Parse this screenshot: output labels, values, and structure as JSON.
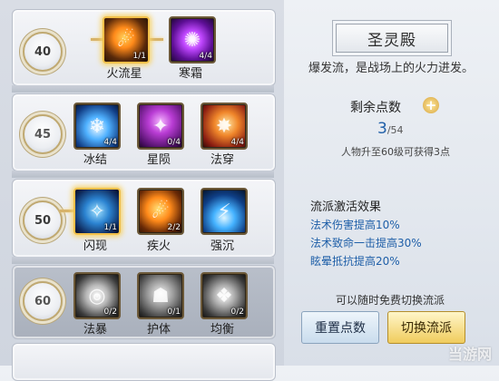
{
  "talent_tree": {
    "rows": [
      {
        "level": "40",
        "skills": [
          {
            "name": "火流星",
            "count": "1/1",
            "icon": "meteor-icon",
            "selected": true
          },
          {
            "name": "寒霜",
            "count": "4/4",
            "icon": "frost-icon"
          }
        ]
      },
      {
        "level": "45",
        "skills": [
          {
            "name": "冰结",
            "count": "4/4",
            "icon": "freeze-icon"
          },
          {
            "name": "星陨",
            "count": "0/4",
            "icon": "star-fall-icon"
          },
          {
            "name": "法穿",
            "count": "4/4",
            "icon": "spell-pierce-icon"
          }
        ]
      },
      {
        "level": "50",
        "skills": [
          {
            "name": "闪现",
            "count": "1/1",
            "icon": "flash-icon",
            "selected": true
          },
          {
            "name": "疾火",
            "count": "2/2",
            "icon": "swift-fire-icon"
          },
          {
            "name": "强沉",
            "count": "",
            "icon": "sink-icon"
          }
        ]
      },
      {
        "level": "60",
        "locked": true,
        "skills": [
          {
            "name": "法暴",
            "count": "0/2",
            "icon": "spell-crit-icon"
          },
          {
            "name": "护体",
            "count": "0/1",
            "icon": "guard-icon"
          },
          {
            "name": "均衡",
            "count": "0/2",
            "icon": "balance-icon"
          }
        ]
      }
    ]
  },
  "info": {
    "title": "圣灵殿",
    "description": "爆发流，是战场上的火力进发。",
    "remaining_label": "剩余点数",
    "points_current": "3",
    "points_max": "/54",
    "hint": "人物升至60级可获得3点",
    "effects_title": "流派激活效果",
    "effects": [
      "法术伤害提高10%",
      "法术致命一击提高30%",
      "眩晕抵抗提高20%"
    ],
    "switch_hint": "可以随时免费切换流派",
    "reset_button": "重置点数",
    "switch_button": "切换流派"
  },
  "watermark": "当游网",
  "colors": {
    "accent_blue": "#1f5fa8",
    "gold": "#f0cc5d"
  }
}
